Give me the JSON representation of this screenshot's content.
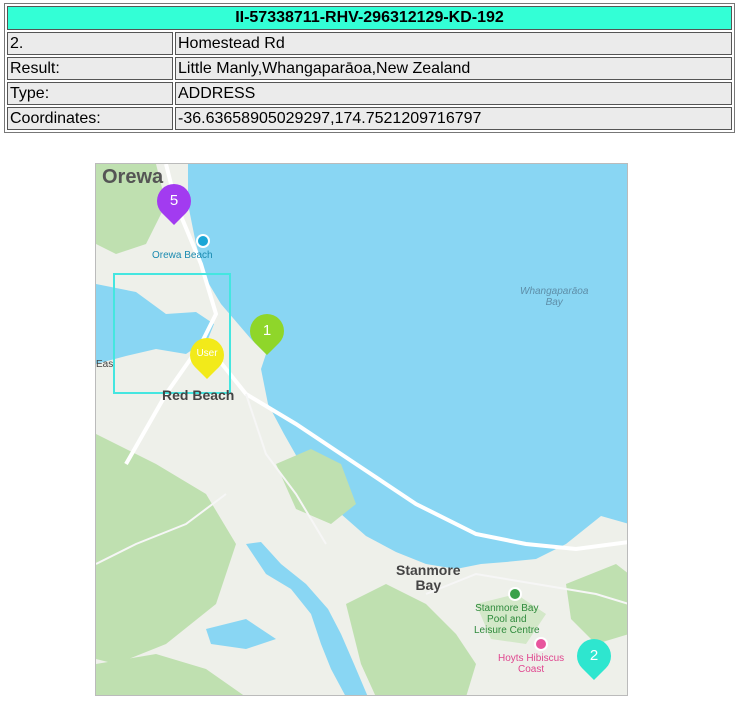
{
  "info": {
    "title": "II-57338711-RHV-296312129-KD-192",
    "rows": [
      {
        "key": "2.",
        "value": "Homestead Rd"
      },
      {
        "key": "Result:",
        "value": "Little Manly,Whangaparāoa,New Zealand"
      },
      {
        "key": "Type:",
        "value": "ADDRESS"
      },
      {
        "key": "Coordinates:",
        "value": "-36.63658905029297,174.7521209716797"
      }
    ]
  },
  "map": {
    "labels": {
      "orewa": "Orewa",
      "orewa_beach": "Orewa Beach",
      "bay_line1": "Whangaparāoa",
      "bay_line2": "Bay",
      "east": "Eas",
      "red_beach": "Red Beach",
      "stanmore_line1": "Stanmore",
      "stanmore_line2": "Bay",
      "pool_line1": "Stanmore Bay",
      "pool_line2": "Pool and",
      "pool_line3": "Leisure Centre",
      "hoyts_line1": "Hoyts Hibiscus",
      "hoyts_line2": "Coast"
    },
    "markers": [
      {
        "label": "5",
        "color": "#a23bf0"
      },
      {
        "label": "1",
        "color": "#8fd62a"
      },
      {
        "label": "User",
        "color": "#f2ea1a"
      },
      {
        "label": "2",
        "color": "#2ee6cf"
      }
    ],
    "colors": {
      "water": "#89d6f3",
      "land": "#eef0ea",
      "park": "#bfe0b0",
      "selection": "#44e6e0"
    }
  }
}
